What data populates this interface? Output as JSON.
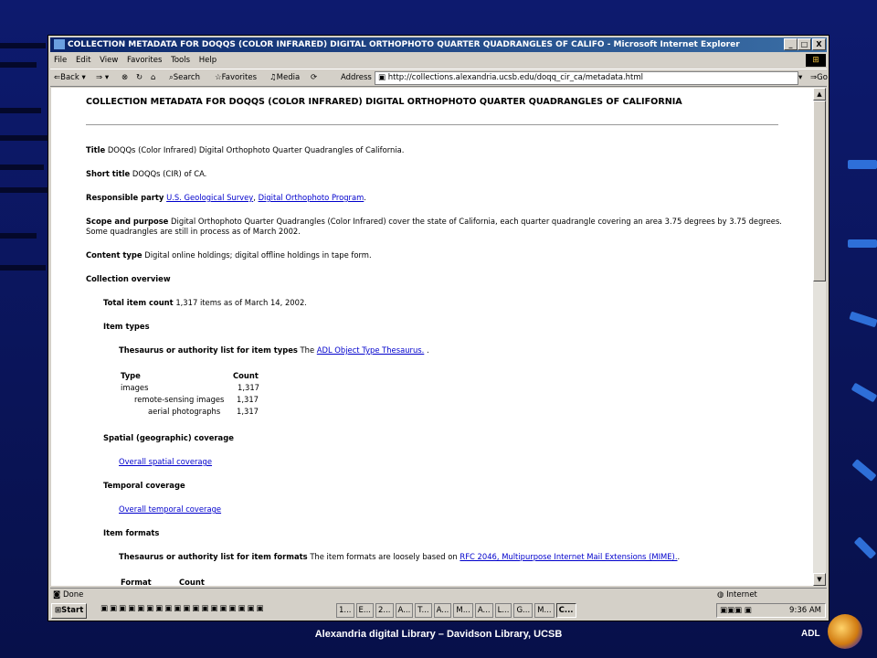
{
  "window": {
    "title": "COLLECTION METADATA FOR DOQQS (COLOR INFRARED) DIGITAL ORTHOPHOTO QUARTER QUADRANGLES OF CALIFO - Microsoft Internet Explorer",
    "minimize_label": "_",
    "restore_label": "□",
    "close_label": "X"
  },
  "menu": [
    "File",
    "Edit",
    "View",
    "Favorites",
    "Tools",
    "Help"
  ],
  "toolbar": {
    "back": "Back",
    "search": "Search",
    "favorites": "Favorites",
    "media": "Media",
    "address_label": "Address",
    "address_value": "http://collections.alexandria.ucsb.edu/doqq_cir_ca/metadata.html",
    "go": "Go"
  },
  "page": {
    "heading": "COLLECTION METADATA FOR DOQQS (COLOR INFRARED) DIGITAL ORTHOPHOTO QUARTER QUADRANGLES OF CALIFORNIA",
    "title_label": "Title",
    "title_value": "DOQQs (Color Infrared) Digital Orthophoto Quarter Quadrangles of California.",
    "short_title_label": "Short title",
    "short_title_value": "DOQQs (CIR) of CA.",
    "responsible_label": "Responsible party",
    "responsible_link1": "U.S. Geological Survey",
    "responsible_sep": ",",
    "responsible_link2": "Digital Orthophoto Program",
    "responsible_end": ".",
    "scope_label": "Scope and purpose",
    "scope_line1": "Digital Orthophoto Quarter Quadrangles (Color Infrared) cover the state of California, each quarter quadrangle covering an area 3.75 degrees by 3.75 degrees.",
    "scope_line2": "Some quadrangles are still in process as of March 2002.",
    "content_type_label": "Content type",
    "content_type_value": "Digital online holdings; digital offline holdings in tape form.",
    "overview_label": "Collection overview",
    "total_label": "Total item count",
    "total_value": "1,317 items as of March 14, 2002.",
    "item_types_label": "Item types",
    "thesaurus_types_label": "Thesaurus or authority list for item types",
    "thesaurus_types_pre": "The",
    "thesaurus_types_link": "ADL Object Type Thesaurus.",
    "thesaurus_types_end": ".",
    "type_header": "Type",
    "count_header": "Count",
    "types": [
      {
        "name": "images",
        "count": "1,317"
      },
      {
        "name": "remote-sensing images",
        "count": "1,317"
      },
      {
        "name": "aerial photographs",
        "count": "1,317"
      }
    ],
    "spatial_label": "Spatial (geographic) coverage",
    "spatial_link": "Overall spatial coverage",
    "temporal_label": "Temporal coverage",
    "temporal_link": "Overall temporal coverage",
    "formats_label": "Item formats",
    "thesaurus_formats_label": "Thesaurus or authority list for item formats",
    "thesaurus_formats_pre": "The item formats are loosely based on",
    "thesaurus_formats_link": "RFC 2046, Multipurpose Internet Mail Extensions (MIME).",
    "thesaurus_formats_end": ".",
    "format_header": "Format",
    "format_count_header": "Count"
  },
  "status": {
    "left": "Done",
    "zone": "Internet"
  },
  "taskbar": {
    "start": "Start",
    "tasks": [
      "1...",
      "E...",
      "2...",
      "A...",
      "T...",
      "A...",
      "M...",
      "A...",
      "L...",
      "G...",
      "M...",
      "C..."
    ],
    "clock": "9:36 AM"
  },
  "slide": {
    "footer": "Alexandria digital Library – Davidson Library, UCSB",
    "logo_text": "ADL"
  },
  "colors": {
    "background": "#0d1a6e",
    "title_bar": "#0a246a",
    "link": "#0000cc"
  }
}
